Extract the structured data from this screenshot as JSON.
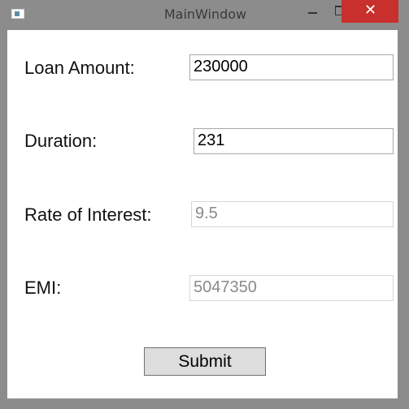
{
  "window": {
    "title": "MainWindow",
    "controls": {
      "minimize": "",
      "maximize": "",
      "close": "✕"
    }
  },
  "form": {
    "loan_amount": {
      "label": "Loan Amount:",
      "value": "230000"
    },
    "duration": {
      "label": "Duration:",
      "value": "231"
    },
    "rate_of_interest": {
      "label": "Rate of Interest:",
      "value": "9.5"
    },
    "emi": {
      "label": "EMI:",
      "value": "5047350"
    },
    "submit_label": "Submit"
  },
  "colors": {
    "close_button": "#c8302d",
    "window_frame": "#8c8c8c",
    "client_bg": "#ffffff",
    "disabled_text": "#8a8a8a"
  },
  "icons": [
    "app-icon",
    "minimize-icon",
    "maximize-icon",
    "close-icon"
  ]
}
